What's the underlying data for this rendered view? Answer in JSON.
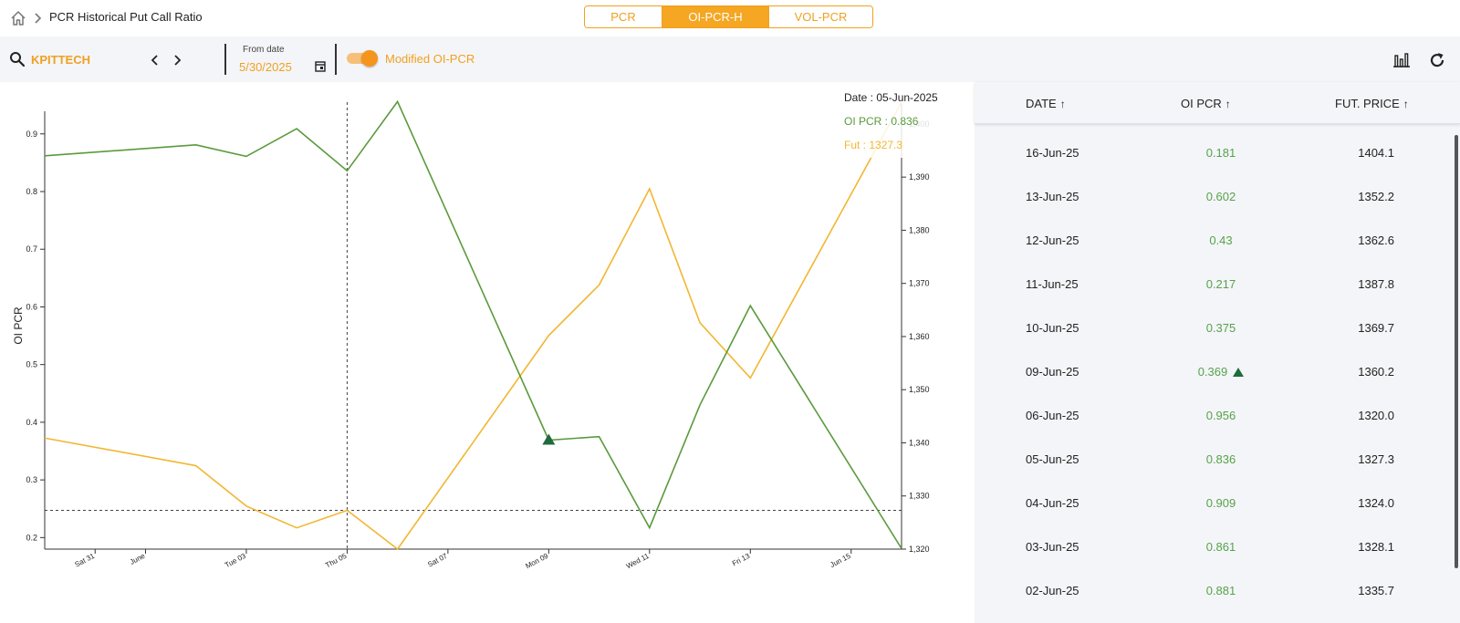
{
  "header": {
    "title": "PCR Historical Put Call Ratio",
    "tabs": [
      {
        "label": "PCR",
        "active": false
      },
      {
        "label": "OI-PCR-H",
        "active": true
      },
      {
        "label": "VOL-PCR",
        "active": false
      }
    ]
  },
  "toolbar": {
    "symbol": "KPITTECH",
    "from_label": "From date",
    "from_value": "5/30/2025",
    "toggle_label": "Modified OI-PCR",
    "toggle_on": true
  },
  "tooltip": {
    "date": "Date : 05-Jun-2025",
    "oi": "OI PCR : 0.836",
    "fut": "Fut : 1327.3"
  },
  "colors": {
    "accent": "#f5a623",
    "oi_line": "#5a9a3c",
    "fut_line": "#f2b632",
    "marker": "#1f6b3e"
  },
  "chart_data": {
    "type": "line",
    "ylabel": "OI PCR",
    "x": [
      "2025-05-30",
      "2025-06-02",
      "2025-06-03",
      "2025-06-04",
      "2025-06-05",
      "2025-06-06",
      "2025-06-09",
      "2025-06-10",
      "2025-06-11",
      "2025-06-12",
      "2025-06-13",
      "2025-06-16"
    ],
    "x_ticks": [
      {
        "date": "2025-05-31",
        "label": "Sat 31"
      },
      {
        "date": "2025-06-01",
        "label": "June"
      },
      {
        "date": "2025-06-03",
        "label": "Tue 03"
      },
      {
        "date": "2025-06-05",
        "label": "Thu 05"
      },
      {
        "date": "2025-06-07",
        "label": "Sat 07"
      },
      {
        "date": "2025-06-09",
        "label": "Mon 09"
      },
      {
        "date": "2025-06-11",
        "label": "Wed 11"
      },
      {
        "date": "2025-06-13",
        "label": "Fri 13"
      },
      {
        "date": "2025-06-15",
        "label": "Jun 15"
      }
    ],
    "x_range": [
      "2025-05-30",
      "2025-06-16"
    ],
    "series": [
      {
        "axis": "left",
        "values": [
          0.862,
          0.881,
          0.861,
          0.909,
          0.836,
          0.956,
          0.369,
          0.375,
          0.217,
          0.43,
          0.602,
          0.181
        ]
      },
      {
        "axis": "right",
        "values": [
          1340.9,
          1335.7,
          1328.1,
          1324.0,
          1327.3,
          1320.0,
          1360.2,
          1369.7,
          1387.8,
          1362.6,
          1352.2,
          1404.1
        ]
      }
    ],
    "y_left": {
      "range": [
        0.18,
        0.955
      ],
      "ticks": [
        "0.2",
        "0.3",
        "0.4",
        "0.5",
        "0.6",
        "0.7",
        "0.8",
        "0.9"
      ]
    },
    "y_right": {
      "range": [
        1320,
        1404.1
      ],
      "ticks": [
        "1,320",
        "1,330",
        "1,340",
        "1,350",
        "1,360",
        "1,370",
        "1,380",
        "1,390",
        "1,400"
      ]
    },
    "marker": {
      "date": "2025-06-09",
      "value": 0.369,
      "shape": "triangle-up"
    },
    "crosshair": {
      "date": "2025-06-05",
      "value": 1327.3
    }
  },
  "table": {
    "columns": [
      {
        "label": "DATE",
        "arrow": "↑"
      },
      {
        "label": "OI PCR",
        "arrow": "↑"
      },
      {
        "label": "FUT. PRICE",
        "arrow": "↑"
      }
    ],
    "rows": [
      {
        "date": "16-Jun-25",
        "oi": "0.181",
        "fut": "1404.1",
        "marker": false
      },
      {
        "date": "13-Jun-25",
        "oi": "0.602",
        "fut": "1352.2",
        "marker": false
      },
      {
        "date": "12-Jun-25",
        "oi": "0.43",
        "fut": "1362.6",
        "marker": false
      },
      {
        "date": "11-Jun-25",
        "oi": "0.217",
        "fut": "1387.8",
        "marker": false
      },
      {
        "date": "10-Jun-25",
        "oi": "0.375",
        "fut": "1369.7",
        "marker": false
      },
      {
        "date": "09-Jun-25",
        "oi": "0.369",
        "fut": "1360.2",
        "marker": true
      },
      {
        "date": "06-Jun-25",
        "oi": "0.956",
        "fut": "1320.0",
        "marker": false
      },
      {
        "date": "05-Jun-25",
        "oi": "0.836",
        "fut": "1327.3",
        "marker": false
      },
      {
        "date": "04-Jun-25",
        "oi": "0.909",
        "fut": "1324.0",
        "marker": false
      },
      {
        "date": "03-Jun-25",
        "oi": "0.861",
        "fut": "1328.1",
        "marker": false
      },
      {
        "date": "02-Jun-25",
        "oi": "0.881",
        "fut": "1335.7",
        "marker": false
      }
    ]
  }
}
